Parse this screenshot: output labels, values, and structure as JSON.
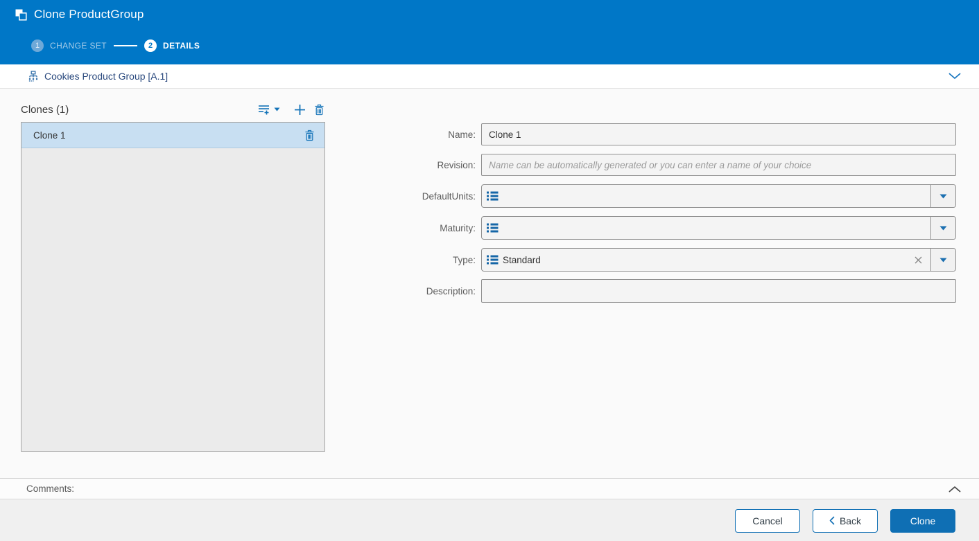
{
  "colors": {
    "header_blue": "#0077C7",
    "accent_blue": "#1473B8",
    "primary_button_blue": "#0F6FB4",
    "selected_item_blue": "#C8DFF2",
    "breadcrumb_text_blue": "#29487D"
  },
  "header": {
    "title": "Clone ProductGroup",
    "title_icon": "clone-icon",
    "steps": [
      {
        "number": "1",
        "label": "CHANGE SET",
        "state": "inactive"
      },
      {
        "number": "2",
        "label": "DETAILS",
        "state": "active"
      }
    ]
  },
  "breadcrumb": {
    "icon": "product-group-icon",
    "label": "Cookies Product Group [A.1]",
    "collapse_icon": "chevron-down-icon"
  },
  "clones_panel": {
    "title": "Clones (1)",
    "toolbar_icons": [
      "add-multiple-icon",
      "dropdown-caret-icon",
      "add-icon",
      "delete-icon"
    ],
    "items": [
      {
        "name": "Clone 1",
        "selected": true,
        "row_icon": "delete-icon"
      }
    ]
  },
  "form": {
    "name": {
      "label": "Name:",
      "value": "Clone 1"
    },
    "revision": {
      "label": "Revision:",
      "value": "",
      "placeholder": "Name can be automatically generated or you can enter a name of your choice"
    },
    "default_units": {
      "label": "DefaultUnits:",
      "value": "",
      "icon": "list-icon"
    },
    "maturity": {
      "label": "Maturity:",
      "value": "",
      "icon": "list-icon"
    },
    "type": {
      "label": "Type:",
      "value": "Standard",
      "icon": "list-icon",
      "clearable": true
    },
    "description": {
      "label": "Description:",
      "value": ""
    }
  },
  "comments": {
    "label": "Comments:",
    "collapse_icon": "chevron-up-icon"
  },
  "footer": {
    "cancel": "Cancel",
    "back": "Back",
    "clone": "Clone"
  }
}
